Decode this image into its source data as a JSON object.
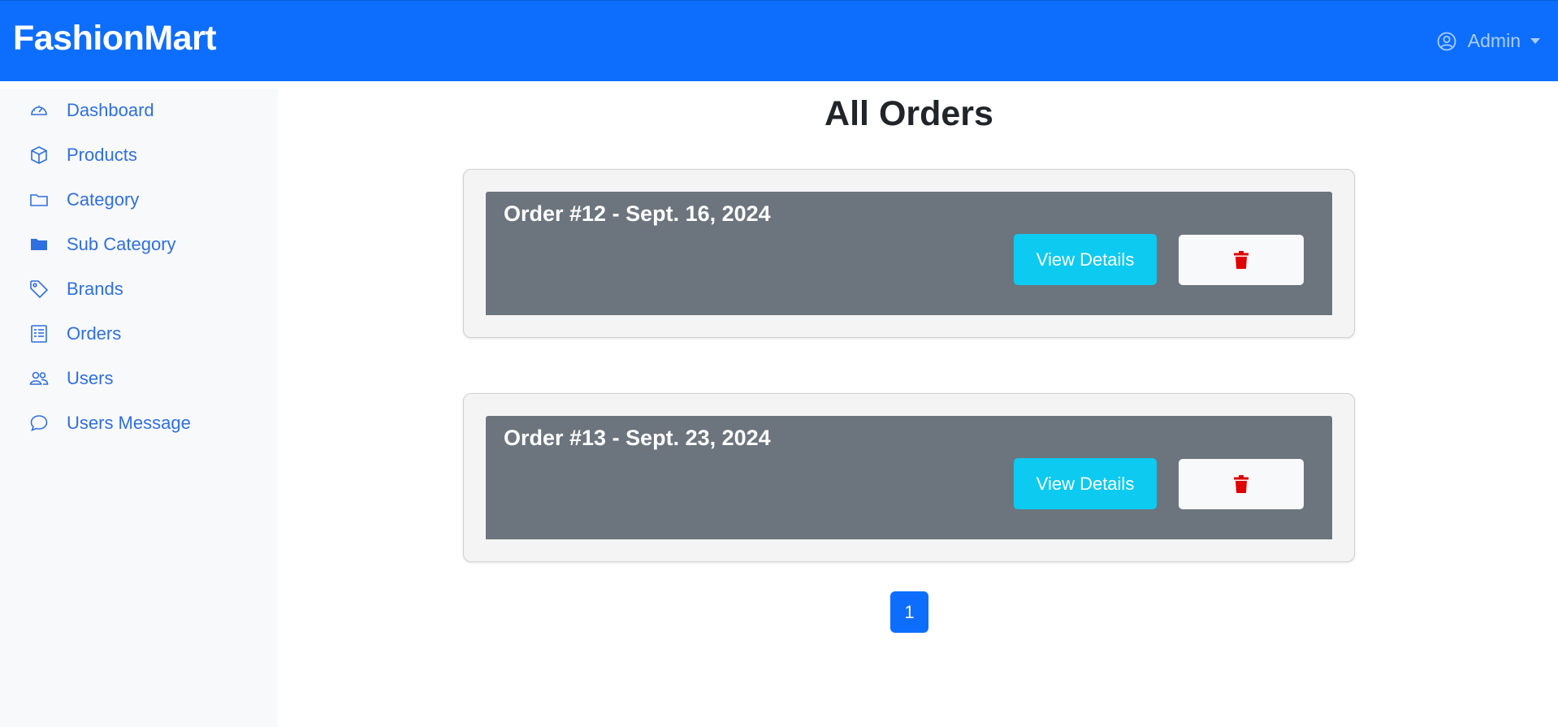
{
  "navbar": {
    "brand": "FashionMart",
    "user_label": "Admin",
    "user_icon": "user-circle-icon"
  },
  "sidebar": {
    "items": [
      {
        "label": "Dashboard",
        "icon": "speedometer-icon"
      },
      {
        "label": "Products",
        "icon": "box-icon"
      },
      {
        "label": "Category",
        "icon": "folder-icon"
      },
      {
        "label": "Sub Category",
        "icon": "folder-filled-icon"
      },
      {
        "label": "Brands",
        "icon": "tag-icon"
      },
      {
        "label": "Orders",
        "icon": "receipt-icon"
      },
      {
        "label": "Users",
        "icon": "people-icon"
      },
      {
        "label": "Users Message",
        "icon": "chat-icon"
      }
    ]
  },
  "main": {
    "title": "All Orders",
    "orders": [
      {
        "title": "Order #12 - Sept. 16, 2024",
        "view_label": "View Details",
        "delete_icon": "trash-icon"
      },
      {
        "title": "Order #13 - Sept. 23, 2024",
        "view_label": "View Details",
        "delete_icon": "trash-icon"
      }
    ],
    "pagination": {
      "current_page": "1"
    }
  },
  "colors": {
    "primary": "#0d6efd",
    "info": "#0dcaf0",
    "secondary": "#6c757d",
    "danger": "#e00000",
    "sidebar_text": "#2f6fe0"
  }
}
